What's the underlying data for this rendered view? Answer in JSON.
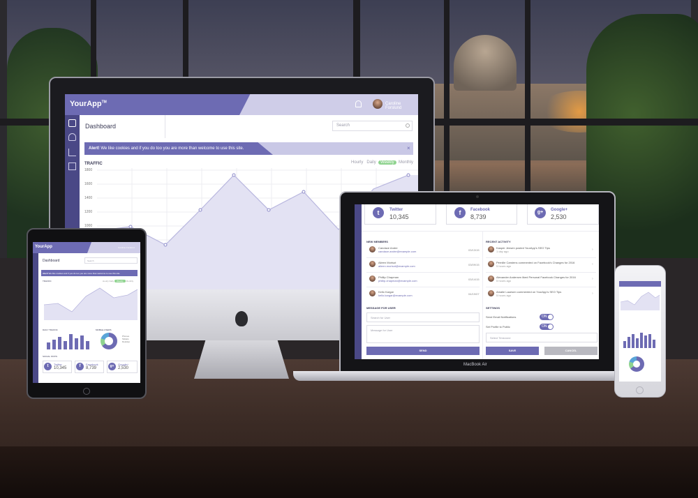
{
  "app": {
    "brand": "YourApp",
    "brand_mark": "TM",
    "user_name": "Caroline Forslund"
  },
  "desktop": {
    "page_title": "Dashboard",
    "search_placeholder": "Search",
    "alert_strong": "Alert!",
    "alert_text": " We like cookies and if you do too you are more than welcome to use this site.",
    "alert_close": "×",
    "traffic_title": "TRAFFIC",
    "range_tabs": [
      "Hourly",
      "Daily",
      "Weekly",
      "Monthly"
    ],
    "active_range": "Weekly",
    "y_ticks": [
      "1800",
      "1600",
      "1400",
      "1200",
      "1000"
    ]
  },
  "laptop": {
    "social": [
      {
        "name": "Twitter",
        "count": "10,345",
        "icon": "twitter-icon",
        "glyph": "t"
      },
      {
        "name": "Facebook",
        "count": "8,739",
        "icon": "facebook-icon",
        "glyph": "f"
      },
      {
        "name": "Google+",
        "count": "2,530",
        "icon": "google-plus-icon",
        "glyph": "g+"
      }
    ],
    "new_members_title": "NEW MEMBERS",
    "members": [
      {
        "name": "Candace Andre",
        "email": "candace.andre@example.com",
        "date": "03/13/15"
      },
      {
        "name": "Aileen Morisot",
        "email": "aileen.morisot@example.com",
        "date": "03/09/15"
      },
      {
        "name": "Phillip Chapman",
        "email": "phillip.chapman@example.com",
        "date": "03/14/15"
      },
      {
        "name": "Kello Kargar",
        "email": "kello.kargar@example.com",
        "date": "04/19/07"
      }
    ],
    "recent_activity_title": "RECENT ACTIVITY",
    "activity": [
      {
        "text": "Kasper Jensen posted YourApp's SEO Tips",
        "time": "1 day ago"
      },
      {
        "text": "Pernille Carstens commented on Facebook's Changes for 2016",
        "time": "5 hours ago"
      },
      {
        "text": "Alexander Andersen liked Personal Facebook Changes for 2016",
        "time": "5 hours ago"
      },
      {
        "text": "Amalie Lauesen commented on YourApp's SEO Tips",
        "time": "5 hours ago"
      }
    ],
    "message_title": "MESSAGE FOR USER",
    "search_user_placeholder": "Search for User",
    "message_placeholder": "Message for User",
    "send_label": "SEND",
    "settings_title": "SETTINGS",
    "settings": [
      {
        "label": "Send Email Notifications",
        "state": "ON"
      },
      {
        "label": "Set Profile to Public",
        "state": "ON"
      }
    ],
    "timezone_placeholder": "Select Timezone",
    "save_label": "SAVE",
    "cancel_label": "CANCEL",
    "model_label": "MacBook Air"
  },
  "tablet": {
    "page_title": "Dashboard",
    "search_placeholder": "Search",
    "alert_strong": "Alert!",
    "alert_text": " We like cookies and if you do too you are more than welcome to use this site.",
    "traffic_title": "TRAFFIC",
    "range_tabs": [
      "Hourly",
      "Daily",
      "Weekly",
      "Monthly"
    ],
    "daily_traffic_title": "DAILY TRAFFIC",
    "mobile_users_title": "MOBILE USERS",
    "legend": [
      "Phones",
      "Tablets",
      "Desktop"
    ],
    "social_stats_title": "SOCIAL STATS",
    "social": [
      {
        "name": "Twitter",
        "count": "10,345",
        "glyph": "t"
      },
      {
        "name": "Facebook",
        "count": "8,739",
        "glyph": "f"
      },
      {
        "name": "Google+",
        "count": "2,530",
        "glyph": "g+"
      }
    ]
  },
  "colors": {
    "accent": "#6d6bb3",
    "accent_dark": "#4a4886",
    "accent_light": "#cfcde8",
    "success": "#8fd38f",
    "chart_fill": "#e3e2f3"
  }
}
